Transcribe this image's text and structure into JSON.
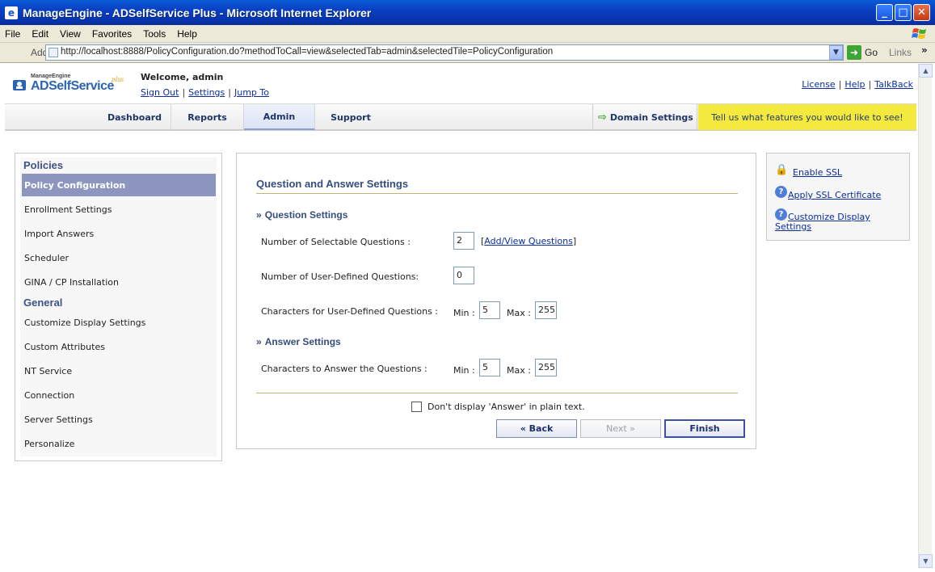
{
  "window": {
    "title": "ManageEngine - ADSelfService Plus - Microsoft Internet Explorer",
    "minimize": "_",
    "maximize": "□",
    "close": "✕"
  },
  "menu": [
    "File",
    "Edit",
    "View",
    "Favorites",
    "Tools",
    "Help"
  ],
  "address": {
    "label": "Address",
    "url": "http://localhost:8888/PolicyConfiguration.do?methodToCall=view&selectedTab=admin&selectedTile=PolicyConfiguration",
    "go_label": "Go",
    "links_label": "Links"
  },
  "brand": {
    "company": "ManageEngine",
    "ad": "AD",
    "product": "SelfService",
    "plus": "plus"
  },
  "header": {
    "welcome": "Welcome, admin",
    "sign_out": "Sign Out",
    "settings": "Settings",
    "jump_to": "Jump To",
    "license": "License",
    "help": "Help",
    "talkback": "TalkBack",
    "sep": "|"
  },
  "tabs": {
    "dashboard": "Dashboard",
    "reports": "Reports",
    "admin": "Admin",
    "support": "Support",
    "domain_settings": "Domain Settings",
    "feature_banner": "Tell us what features you would like to see!"
  },
  "leftnav": {
    "policies_heading": "Policies",
    "general_heading": "General",
    "policies": [
      "Policy Configuration",
      "Enrollment Settings",
      "Import Answers",
      "Scheduler",
      "GINA / CP Installation"
    ],
    "general": [
      "Customize Display Settings",
      "Custom Attributes",
      "NT Service",
      "Connection",
      "Server Settings",
      "Personalize"
    ]
  },
  "main": {
    "title": "Question and Answer Settings",
    "question_settings": "Question Settings",
    "answer_settings": "Answer Settings",
    "num_selectable_label": "Number of Selectable Questions :",
    "num_selectable_value": "2",
    "add_view_questions": "Add/View Questions",
    "bracket_open": "[",
    "bracket_close": "]",
    "num_user_defined_label": "Number of User-Defined Questions:",
    "num_user_defined_value": "0",
    "chars_user_defined_label": "Characters for User-Defined Questions :",
    "chars_user_defined_min": "5",
    "chars_user_defined_max": "255",
    "chars_answer_label": "Characters to Answer the Questions :",
    "chars_answer_min": "5",
    "chars_answer_max": "255",
    "min_label": "Min :",
    "max_label": "Max :",
    "plain_text_checkbox": "Don't display 'Answer' in plain text.",
    "back_button": "« Back",
    "next_button": "Next »",
    "finish_button": "Finish"
  },
  "right": {
    "enable_ssl": "Enable SSL",
    "apply_ssl": "Apply SSL Certificate",
    "customize_display_1": "Customize Display",
    "customize_display_2": "Settings"
  }
}
